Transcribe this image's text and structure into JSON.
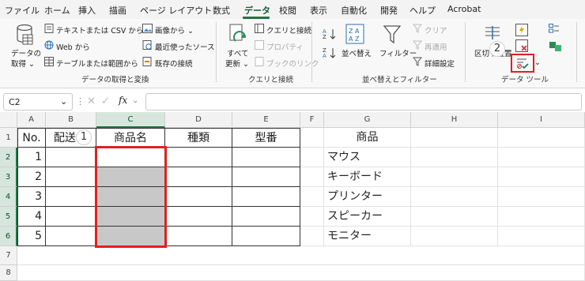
{
  "menu": {
    "items": [
      "ファイル",
      "ホーム",
      "挿入",
      "描画",
      "ページ レイアウト",
      "数式",
      "データ",
      "校閲",
      "表示",
      "自動化",
      "開発",
      "ヘルプ",
      "Acrobat"
    ],
    "active": "データ"
  },
  "ribbon": {
    "get_data": {
      "label1": "データの",
      "label2": "取得 ⌄",
      "from_text_csv": "テキストまたは CSV から",
      "from_web": "Web から",
      "from_table": "テーブルまたは範囲から",
      "from_picture": "画像から ⌄",
      "recent_sources": "最近使ったソース",
      "existing_connections": "既存の接続",
      "group_label": "データの取得と変換"
    },
    "queries": {
      "refresh_all1": "すべて",
      "refresh_all2": "更新 ⌄",
      "queries_connections": "クエリと接続",
      "properties": "プロパティ",
      "edit_links": "ブックのリンク",
      "group_label": "クエリと接続"
    },
    "sort_filter": {
      "sort": "並べ替え",
      "filter": "フィルター",
      "clear": "クリア",
      "reapply": "再適用",
      "advanced": "詳細設定",
      "group_label": "並べ替えとフィルター"
    },
    "data_tools": {
      "text_to_columns": "区切り位置",
      "group_label": "データ ツール"
    }
  },
  "formula_bar": {
    "name_box": "C2",
    "fx": "fx",
    "formula": ""
  },
  "sheet": {
    "columns": [
      "A",
      "B",
      "C",
      "D",
      "E",
      "F",
      "G",
      "H",
      "I"
    ],
    "rows": [
      "1",
      "2",
      "3",
      "4",
      "5",
      "6",
      "7",
      "8"
    ],
    "header": {
      "A": "No.",
      "B": "配送",
      "C": "商品名",
      "D": "種類",
      "E": "型番"
    },
    "numbers": [
      "1",
      "2",
      "3",
      "4",
      "5"
    ],
    "list_title": "商品",
    "list": [
      "マウス",
      "キーボード",
      "プリンター",
      "スピーカー",
      "モニター"
    ]
  },
  "annotations": {
    "step1": "1",
    "step2": "2",
    "color": "#e02020"
  }
}
